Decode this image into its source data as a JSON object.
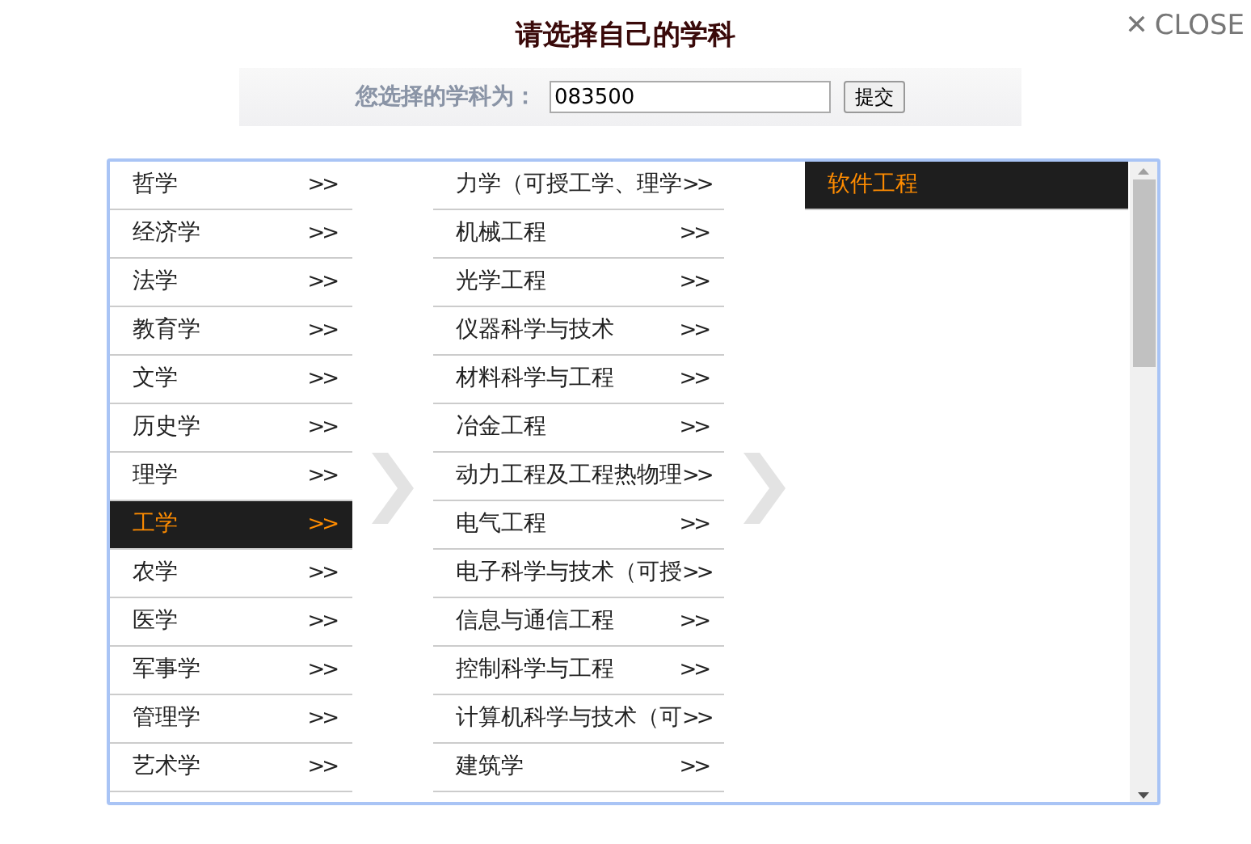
{
  "title": "请选择自己的学科",
  "close": {
    "icon": "✕",
    "label": "CLOSE"
  },
  "selection": {
    "label": "您选择的学科为：",
    "value": "083500",
    "submit": "提交"
  },
  "columns": [
    {
      "items": [
        {
          "label": "哲学",
          "arrow": ">>",
          "selected": false
        },
        {
          "label": "经济学",
          "arrow": ">>",
          "selected": false
        },
        {
          "label": "法学",
          "arrow": ">>",
          "selected": false
        },
        {
          "label": "教育学",
          "arrow": ">>",
          "selected": false
        },
        {
          "label": "文学",
          "arrow": ">>",
          "selected": false
        },
        {
          "label": "历史学",
          "arrow": ">>",
          "selected": false
        },
        {
          "label": "理学",
          "arrow": ">>",
          "selected": false
        },
        {
          "label": "工学",
          "arrow": ">>",
          "selected": true
        },
        {
          "label": "农学",
          "arrow": ">>",
          "selected": false
        },
        {
          "label": "医学",
          "arrow": ">>",
          "selected": false
        },
        {
          "label": "军事学",
          "arrow": ">>",
          "selected": false
        },
        {
          "label": "管理学",
          "arrow": ">>",
          "selected": false
        },
        {
          "label": "艺术学",
          "arrow": ">>",
          "selected": false
        }
      ]
    },
    {
      "items": [
        {
          "label": "力学（可授工学、理学",
          "arrow": ">>",
          "selected": false
        },
        {
          "label": "机械工程",
          "arrow": ">>",
          "selected": false
        },
        {
          "label": "光学工程",
          "arrow": ">>",
          "selected": false
        },
        {
          "label": "仪器科学与技术",
          "arrow": ">>",
          "selected": false
        },
        {
          "label": "材料科学与工程",
          "arrow": ">>",
          "selected": false
        },
        {
          "label": "冶金工程",
          "arrow": ">>",
          "selected": false
        },
        {
          "label": "动力工程及工程热物理",
          "arrow": ">>",
          "selected": false
        },
        {
          "label": "电气工程",
          "arrow": ">>",
          "selected": false
        },
        {
          "label": "电子科学与技术（可授",
          "arrow": ">>",
          "selected": false
        },
        {
          "label": "信息与通信工程",
          "arrow": ">>",
          "selected": false
        },
        {
          "label": "控制科学与工程",
          "arrow": ">>",
          "selected": false
        },
        {
          "label": "计算机科学与技术（可",
          "arrow": ">>",
          "selected": false
        },
        {
          "label": "建筑学",
          "arrow": ">>",
          "selected": false
        }
      ]
    },
    {
      "items": [
        {
          "label": "软件工程",
          "selected": true
        }
      ]
    }
  ]
}
